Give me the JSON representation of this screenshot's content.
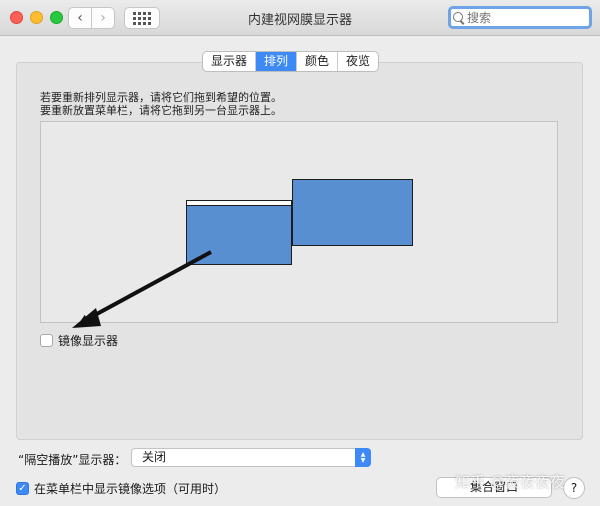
{
  "window": {
    "title": "内建视网膜显示器",
    "search_placeholder": "搜索"
  },
  "tabs": [
    {
      "label": "显示器",
      "active": false
    },
    {
      "label": "排列",
      "active": true
    },
    {
      "label": "颜色",
      "active": false
    },
    {
      "label": "夜览",
      "active": false
    }
  ],
  "instructions": {
    "line1": "若要重新排列显示器，请将它们拖到希望的位置。",
    "line2": "要重新放置菜单栏，请将它拖到另一台显示器上。"
  },
  "mirror": {
    "label": "镜像显示器",
    "checked": false
  },
  "airplay": {
    "label": "“隔空播放”显示器：",
    "value": "关闭"
  },
  "menu_option": {
    "label": "在菜单栏中显示镜像选项（可用时）",
    "checked": true
  },
  "buttons": {
    "gather": "集合窗口",
    "help": "?"
  },
  "watermark": "知乎 @夜夜夜夜",
  "colors": {
    "accent": "#3d8af7",
    "display_fill": "#588fd0"
  }
}
